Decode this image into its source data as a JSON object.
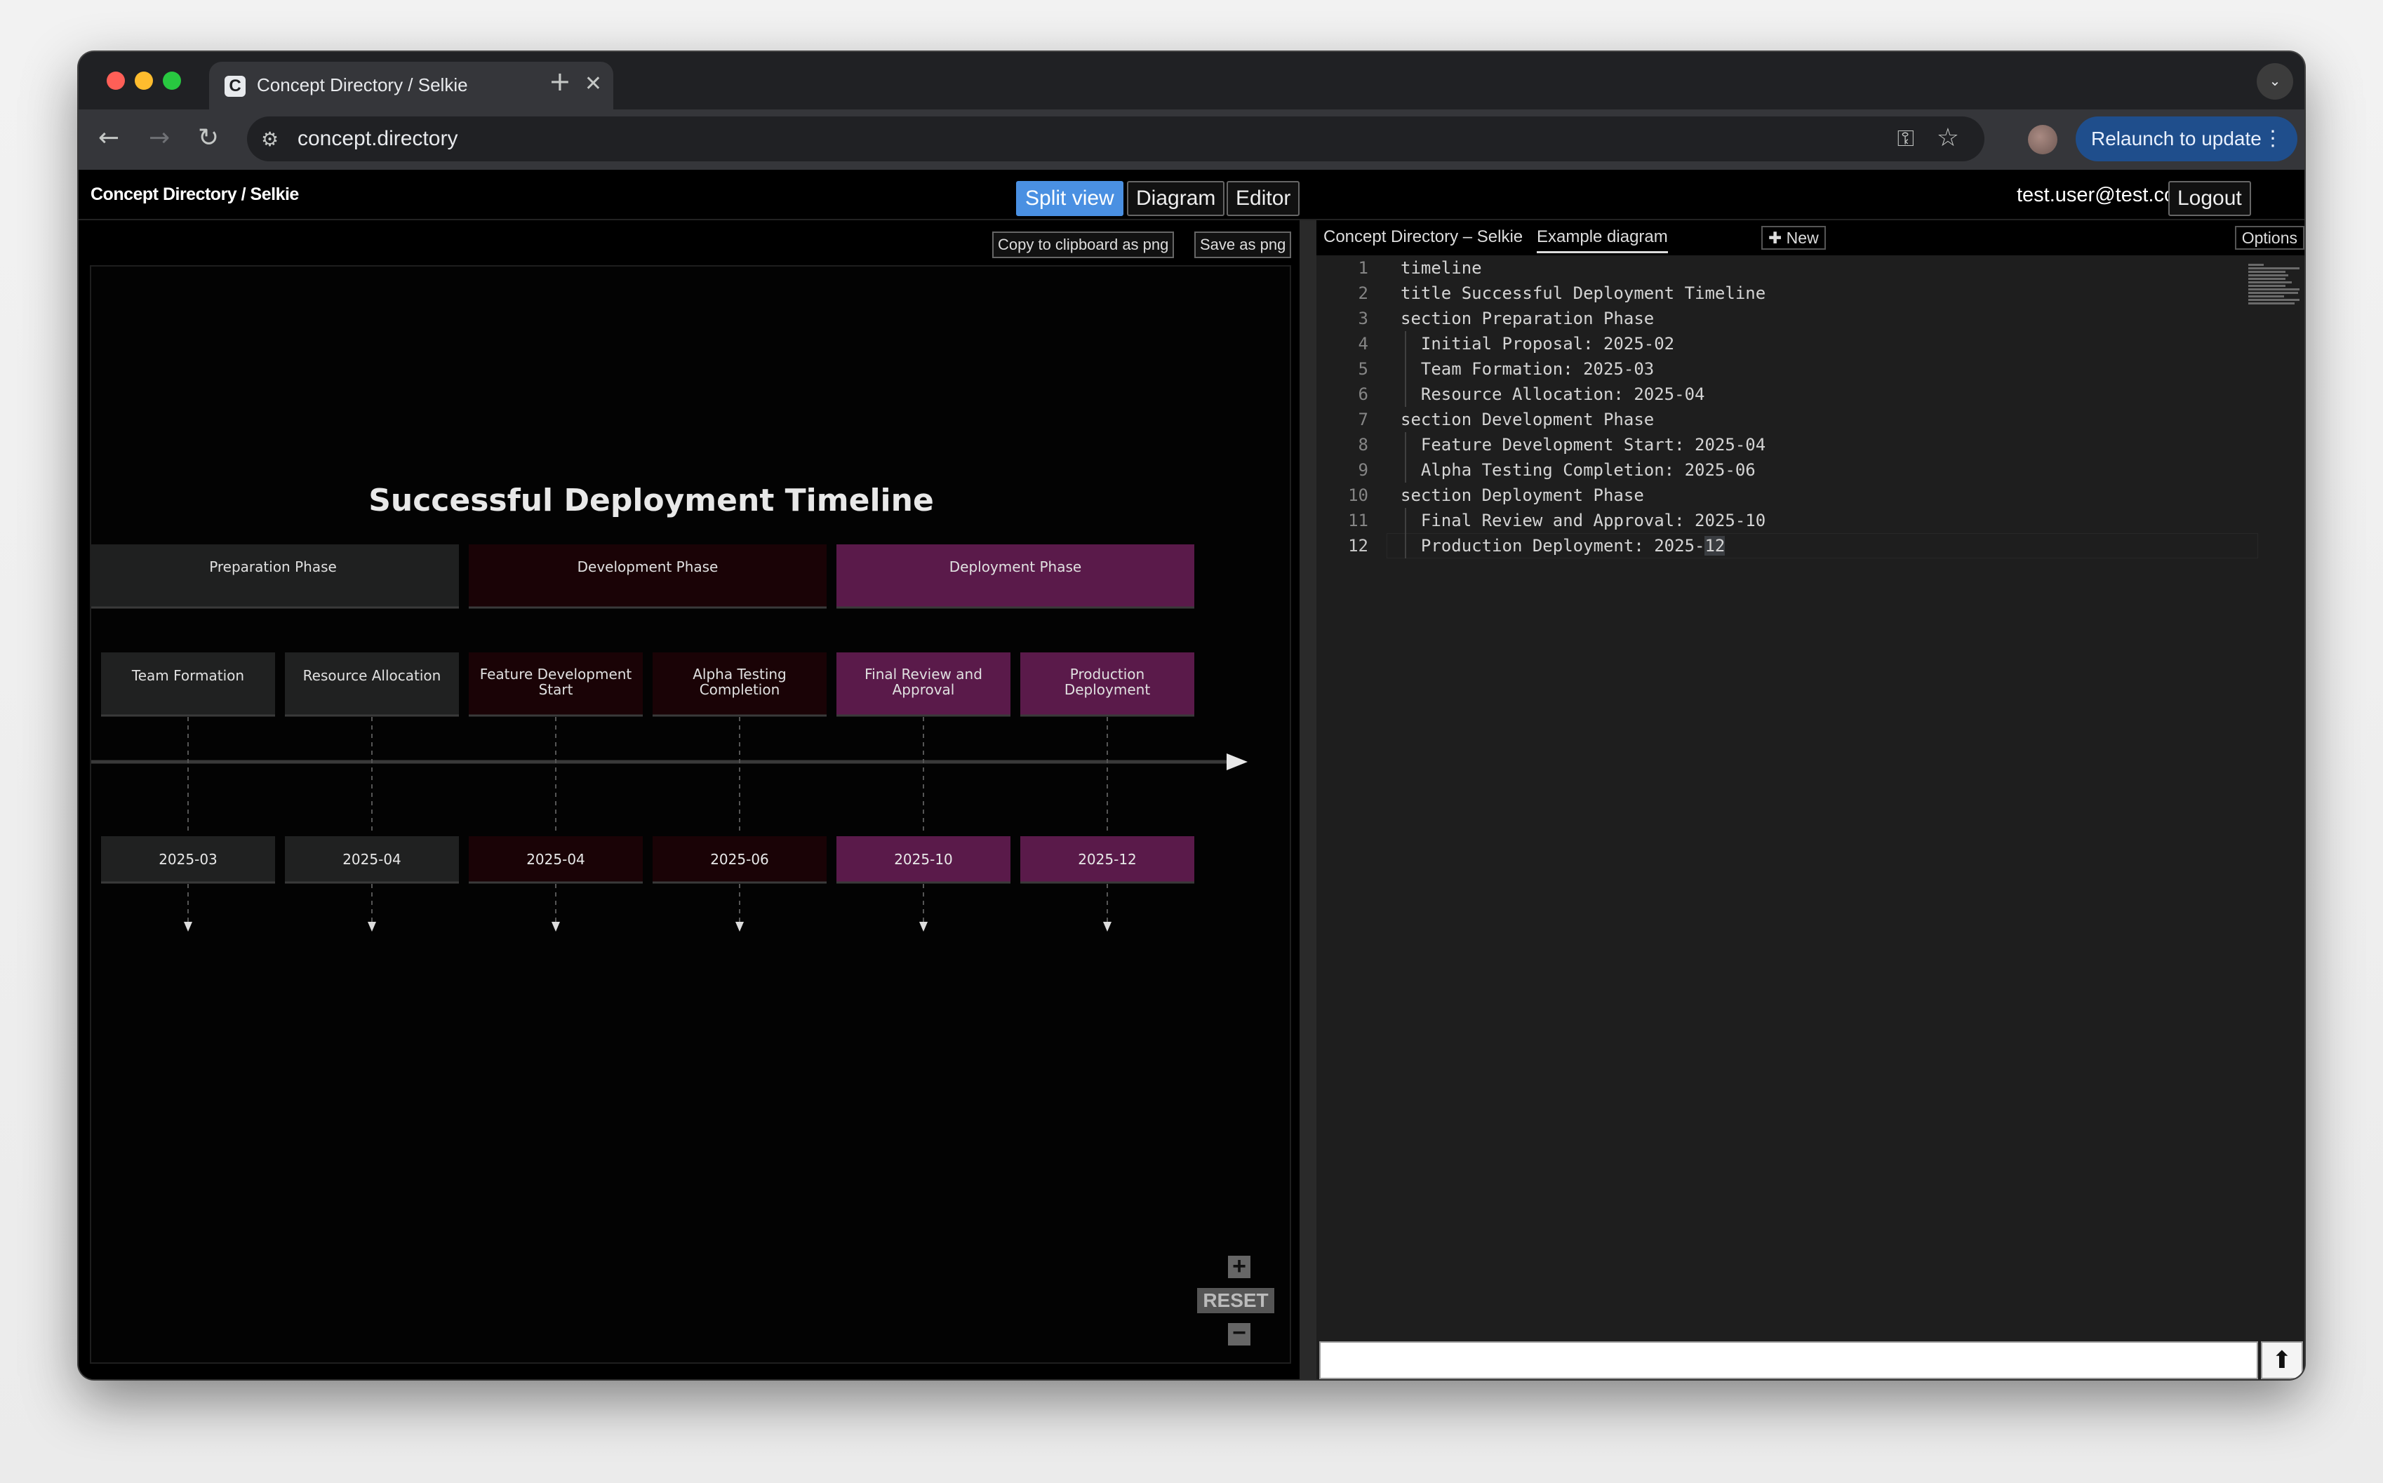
{
  "browser": {
    "tab_title": "Concept Directory / Selkie",
    "tab_favicon_letter": "C",
    "url": "concept.directory",
    "relaunch_label": "Relaunch to update"
  },
  "app": {
    "brand": "Concept Directory / Selkie",
    "views": [
      "Split view",
      "Diagram",
      "Editor"
    ],
    "active_view": "Split view",
    "user_email": "test.user@test.com",
    "logout_label": "Logout"
  },
  "diagram_toolbar": {
    "copy_label": "Copy to clipboard as png",
    "save_label": "Save as png"
  },
  "zoom_controls": {
    "zoom_in": "+",
    "reset": "RESET",
    "zoom_out": "−"
  },
  "timeline": {
    "title": "Successful Deployment Timeline",
    "sections": [
      {
        "name": "Preparation Phase",
        "color": "#1f2020"
      },
      {
        "name": "Development Phase",
        "color": "#1a0306"
      },
      {
        "name": "Deployment Phase",
        "color": "#5a1a4a"
      }
    ],
    "events": [
      {
        "section": 0,
        "label": "Team Formation",
        "date": "2025-03"
      },
      {
        "section": 0,
        "label": "Resource Allocation",
        "date": "2025-04"
      },
      {
        "section": 1,
        "label": "Feature Development Start",
        "date": "2025-04"
      },
      {
        "section": 1,
        "label": "Alpha Testing Completion",
        "date": "2025-06"
      },
      {
        "section": 2,
        "label": "Final Review and Approval",
        "date": "2025-10"
      },
      {
        "section": 2,
        "label": "Production Deployment",
        "date": "2025-12"
      }
    ]
  },
  "editor_tabs": {
    "project": "Concept Directory – Selkie",
    "document": "Example diagram",
    "new_label": "✚ New",
    "options_label": "Options"
  },
  "editor": {
    "current_line": 12,
    "lines": [
      "timeline",
      "title Successful Deployment Timeline",
      "section Preparation Phase",
      "  Initial Proposal: 2025-02",
      "  Team Formation: 2025-03",
      "  Resource Allocation: 2025-04",
      "section Development Phase",
      "  Feature Development Start: 2025-04",
      "  Alpha Testing Completion: 2025-06",
      "section Deployment Phase",
      "  Final Review and Approval: 2025-10",
      "  Production Deployment: 2025-12"
    ]
  },
  "chat": {
    "input_value": "",
    "send_icon": "arrow-up-icon"
  }
}
